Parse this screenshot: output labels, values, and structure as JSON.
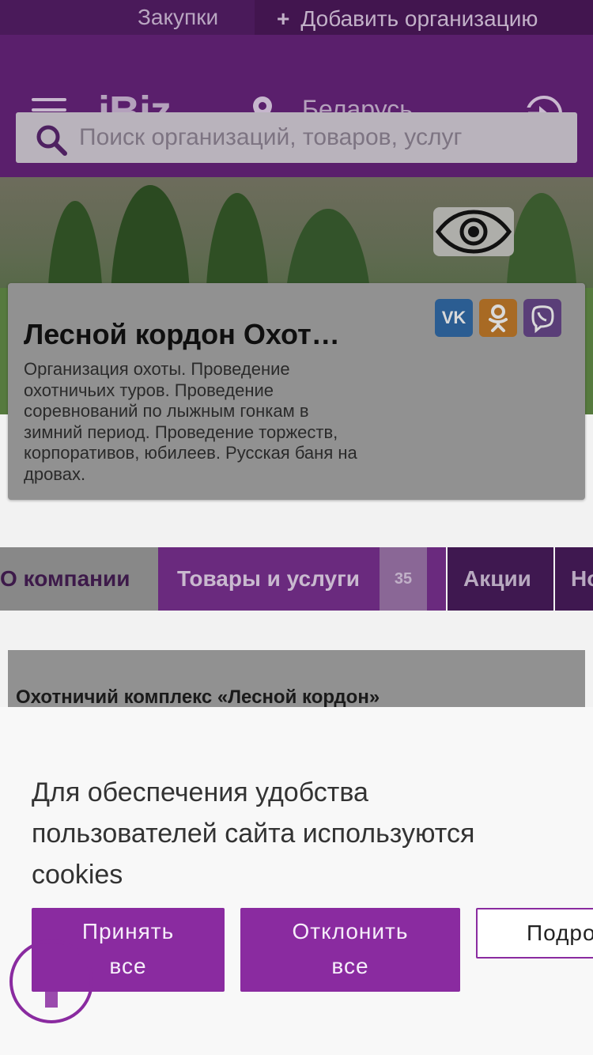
{
  "topbar": {
    "purchases": "Закупки",
    "add_org": "Добавить организацию"
  },
  "header": {
    "logo": "iBiz",
    "country": "Беларусь",
    "search_placeholder": "Поиск организаций, товаров, услуг"
  },
  "company": {
    "title": "Лесной кордон Охот…",
    "description": "Организация охоты. Проведение охотничьих туров. Проведение соревнований по лыжным гонкам в зимний период. Проведение торжеств, корпоративов, юбилеев. Русская баня на дровах.",
    "social": {
      "vk": "VK",
      "ok": "OK"
    }
  },
  "tabs": {
    "about": "О компании",
    "goods": "Товары и услуги",
    "goods_count": "35",
    "promo": "Акции",
    "news": "Но"
  },
  "content": {
    "heading": "Охотничий комплекс «Лесной кордон»"
  },
  "cookie": {
    "message": "Для обеспечения удобства пользователей сайта используются cookies",
    "accept_line1": "Принять",
    "accept_line2": "все",
    "reject_line1": "Отклонить",
    "reject_line2": "все",
    "more": "Подро"
  },
  "colors": {
    "brand": "#8a2ba0",
    "header": "#5a1f6c"
  }
}
